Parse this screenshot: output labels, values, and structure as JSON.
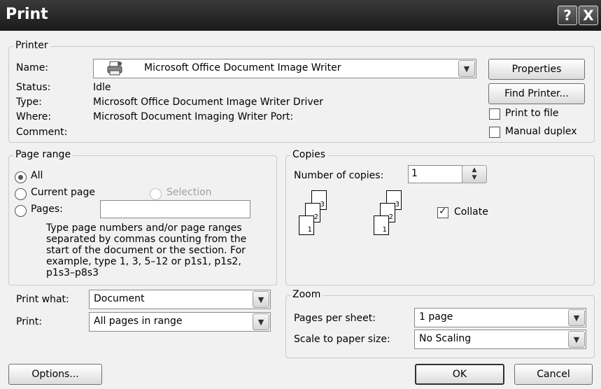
{
  "window": {
    "title": "Print",
    "help_glyph": "?",
    "close_glyph": "X"
  },
  "printer": {
    "legend": "Printer",
    "name_label": "Name:",
    "name_value": "Microsoft Office Document Image Writer",
    "status_label": "Status:",
    "status_value": "Idle",
    "type_label": "Type:",
    "type_value": "Microsoft Office Document Image Writer Driver",
    "where_label": "Where:",
    "where_value": "Microsoft Document Imaging Writer Port:",
    "comment_label": "Comment:",
    "comment_value": "",
    "properties_button": "Properties",
    "find_printer_button": "Find Printer...",
    "print_to_file": {
      "label": "Print to file",
      "checked": false
    },
    "manual_duplex": {
      "label": "Manual duplex",
      "checked": false
    }
  },
  "page_range": {
    "legend": "Page range",
    "all_label": "All",
    "current_label": "Current page",
    "selection_label": "Selection",
    "pages_label": "Pages:",
    "pages_value": "",
    "selected": "All",
    "help_text": "Type page numbers and/or page ranges separated by commas counting from the start of the document or the section. For example, type 1, 3, 5–12 or p1s1, p1s2, p1s3–p8s3"
  },
  "copies": {
    "legend": "Copies",
    "number_label": "Number of copies:",
    "number_value": "1",
    "collate_label": "Collate",
    "collate_checked": true,
    "page_labels": [
      "1",
      "2",
      "3"
    ]
  },
  "print_what": {
    "label": "Print what:",
    "value": "Document"
  },
  "print_select": {
    "label": "Print:",
    "value": "All pages in range"
  },
  "zoom": {
    "legend": "Zoom",
    "pages_per_sheet_label": "Pages per sheet:",
    "pages_per_sheet_value": "1 page",
    "scale_label": "Scale to paper size:",
    "scale_value": "No Scaling"
  },
  "footer": {
    "options_button": "Options...",
    "ok_button": "OK",
    "cancel_button": "Cancel"
  }
}
